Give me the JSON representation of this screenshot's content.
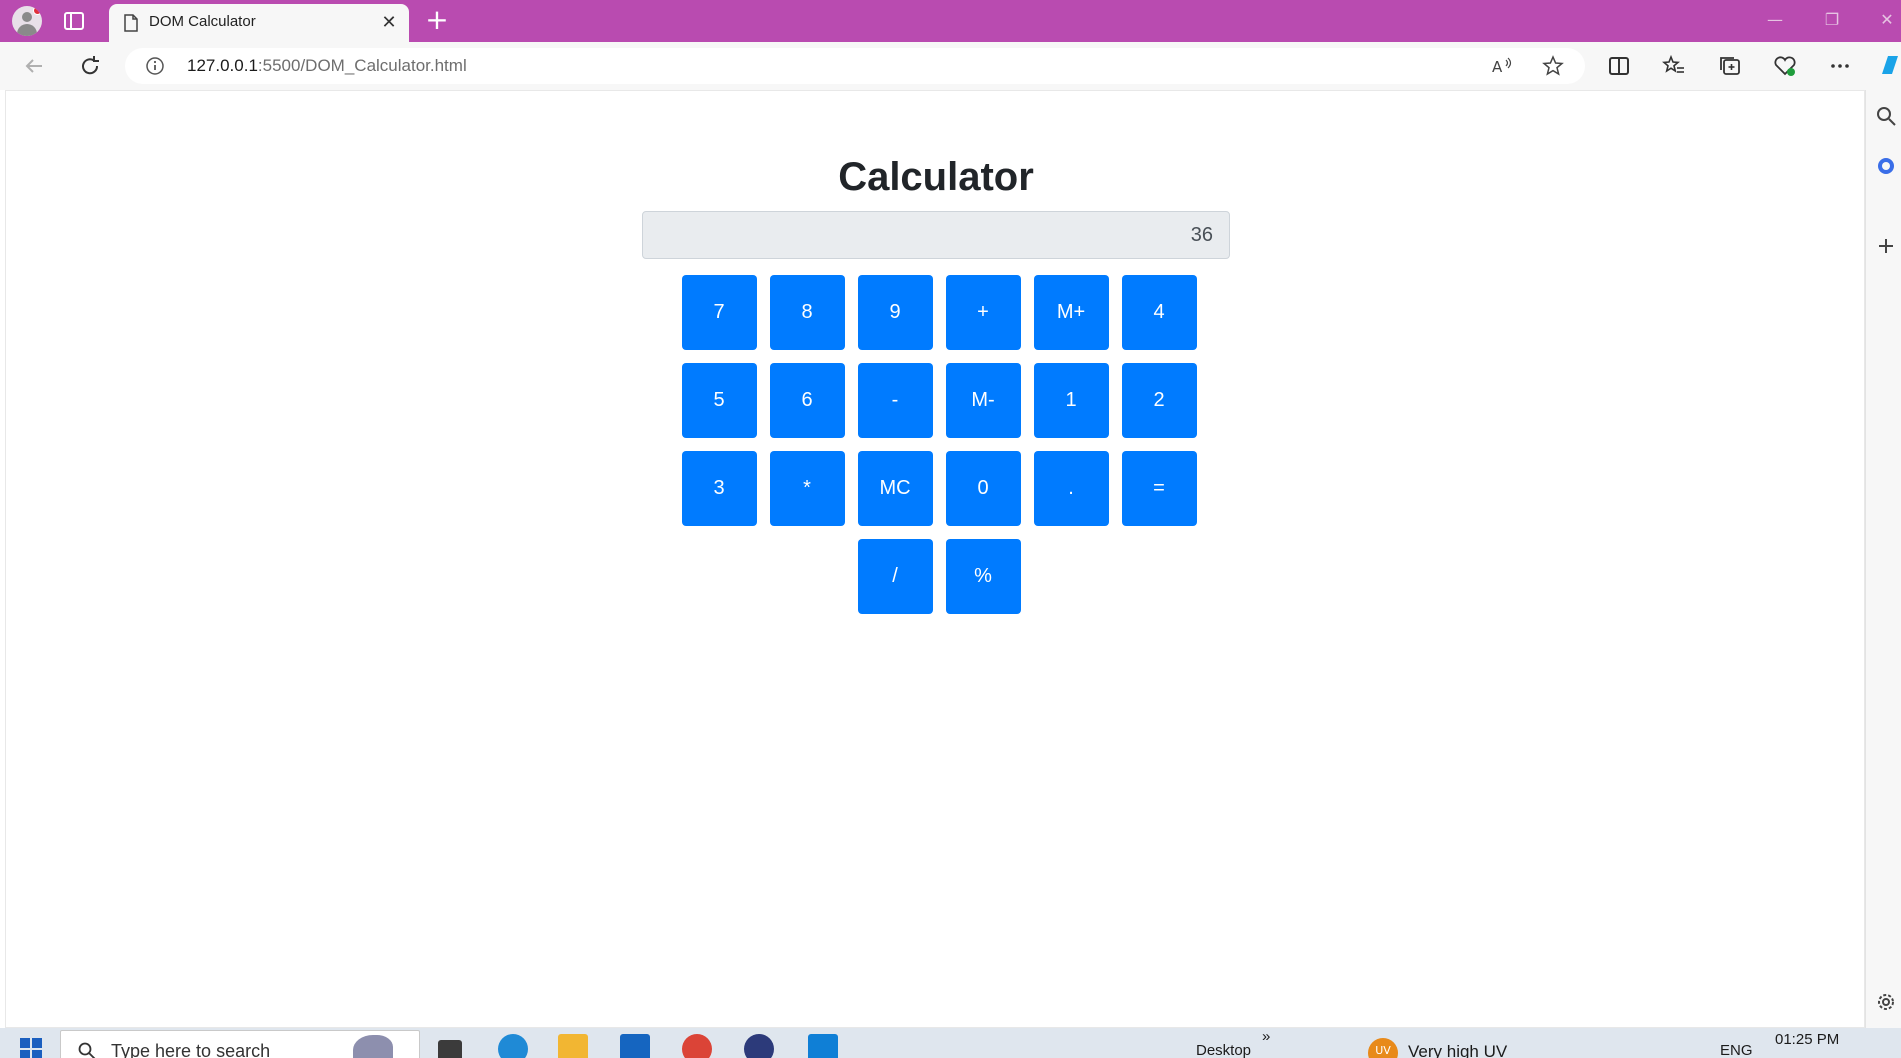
{
  "browser": {
    "tab_title": "DOM Calculator",
    "tab_close": "✕",
    "new_tab": "+",
    "url_host": "127.0.0.1",
    "url_path": ":5500/DOM_Calculator.html",
    "icons": [
      "profile-avatar",
      "tab-actions-icon",
      "page-icon",
      "back-icon",
      "refresh-icon",
      "info-icon",
      "read-aloud-icon",
      "favorite-star-icon",
      "split-screen-icon",
      "favorites-icon",
      "collections-icon",
      "browser-essentials-icon",
      "more-icon",
      "copilot-icon",
      "search-icon",
      "office-icon",
      "add-icon",
      "settings-icon"
    ]
  },
  "calculator": {
    "title": "Calculator",
    "display_value": "36",
    "keys": [
      "7",
      "8",
      "9",
      "+",
      "M+",
      "4",
      "5",
      "6",
      "-",
      "M-",
      "1",
      "2",
      "3",
      "*",
      "MC",
      "0",
      ".",
      "=",
      "/",
      "%"
    ],
    "key_color": "#007bff"
  },
  "taskbar": {
    "search_placeholder": "Type here to search",
    "desktop_label": "Desktop",
    "chevron": "»",
    "weather_badge": "UV",
    "weather_text": "Very high UV",
    "language": "ENG",
    "time": "01:25 PM"
  }
}
